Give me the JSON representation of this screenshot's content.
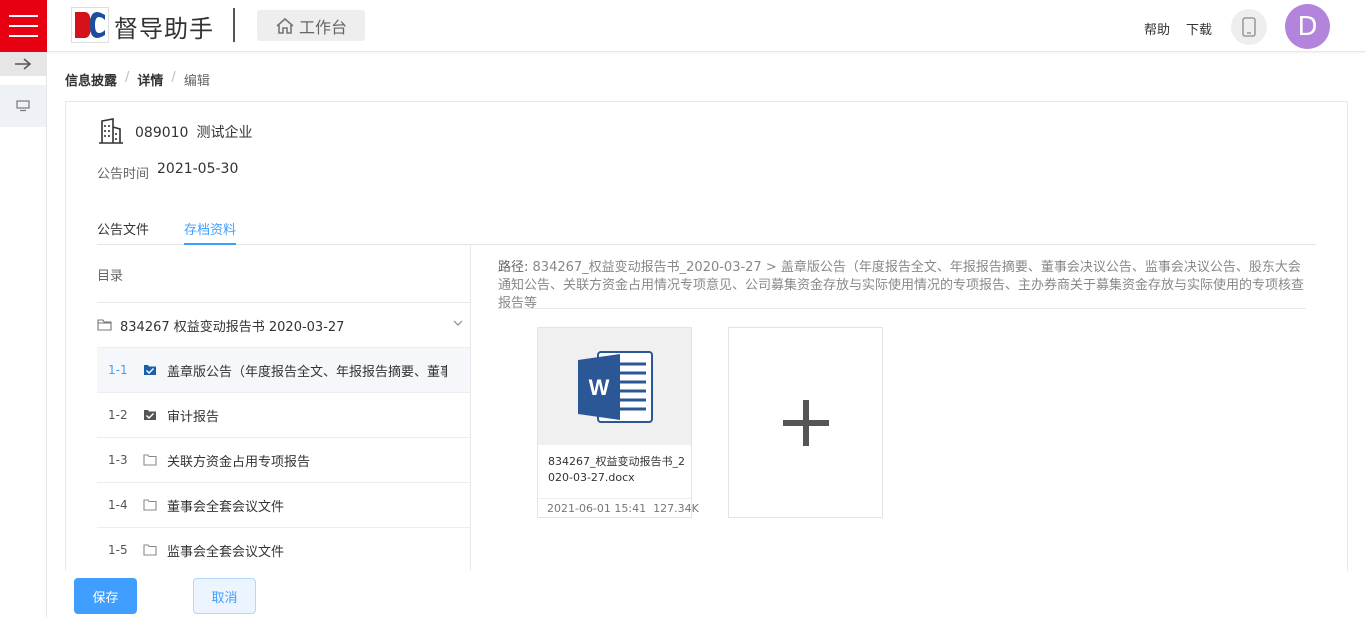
{
  "header": {
    "app_name": "督导助手",
    "workbench_label": "工作台",
    "help_label": "帮助",
    "download_label": "下载",
    "avatar_letter": "D",
    "brand_color": "#e60012",
    "avatar_color": "#b384dc"
  },
  "breadcrumb": {
    "items": [
      "信息披露",
      "详情",
      "编辑"
    ],
    "separator": "/"
  },
  "company": {
    "code": "089010",
    "name": "测试企业",
    "date_label": "公告时间",
    "date_value": "2021-05-30"
  },
  "tabs": [
    {
      "label": "公告文件",
      "active": false
    },
    {
      "label": "存档资料",
      "active": true
    }
  ],
  "tree": {
    "header": "目录",
    "root_folder": "834267  权益变动报告书  2020-03-27",
    "items": [
      {
        "num": "1-1",
        "icon": "folder-check-icon",
        "label": "盖章版公告（年度报告全文、年报报告摘要、董事...",
        "active": true
      },
      {
        "num": "1-2",
        "icon": "folder-check-icon",
        "label": "审计报告",
        "active": false
      },
      {
        "num": "1-3",
        "icon": "folder-icon",
        "label": "关联方资金占用专项报告",
        "active": false
      },
      {
        "num": "1-4",
        "icon": "folder-icon",
        "label": "董事会全套会议文件",
        "active": false
      },
      {
        "num": "1-5",
        "icon": "folder-icon",
        "label": "监事会全套会议文件",
        "active": false
      }
    ]
  },
  "path": {
    "label": "路径:",
    "value": "834267_权益变动报告书_2020-03-27 > 盖章版公告（年度报告全文、年报报告摘要、董事会决议公告、监事会决议公告、股东大会通知公告、关联方资金占用情况专项意见、公司募集资金存放与实际使用情况的专项报告、主办券商关于募集资金存放与实际使用的专项核查报告等"
  },
  "files": [
    {
      "name": "834267_权益变动报告书_2020-03-27.docx",
      "date": "2021-06-01 15:41",
      "size": "127.34K",
      "icon": "word-icon"
    }
  ],
  "add_icon": "plus-icon",
  "footer": {
    "save_label": "保存",
    "cancel_label": "取消",
    "accent_color": "#409eff"
  }
}
